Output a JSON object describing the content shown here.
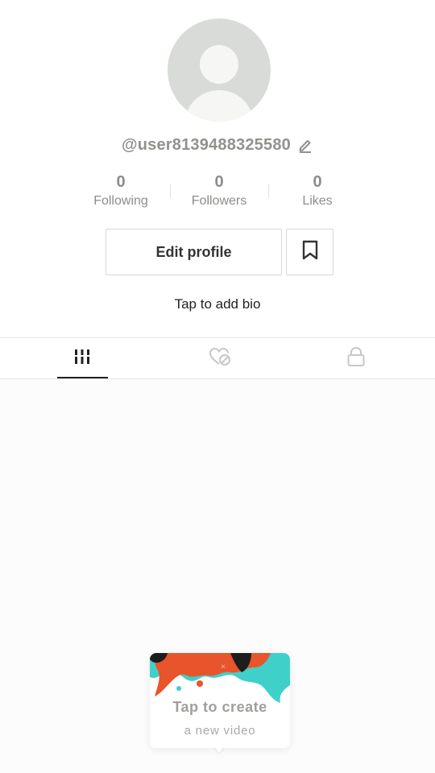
{
  "profile": {
    "username": "@user8139488325580",
    "bio_prompt": "Tap to add bio"
  },
  "stats": [
    {
      "value": "0",
      "label": "Following"
    },
    {
      "value": "0",
      "label": "Followers"
    },
    {
      "value": "0",
      "label": "Likes"
    }
  ],
  "actions": {
    "edit_profile_label": "Edit profile"
  },
  "tabs": [
    {
      "icon": "grid-icon",
      "active": true
    },
    {
      "icon": "liked-hidden-icon",
      "active": false
    },
    {
      "icon": "lock-icon",
      "active": false
    }
  ],
  "create_prompt": {
    "title": "Tap to create",
    "subtitle": "a new video"
  },
  "colors": {
    "accent_orange": "#e8542b",
    "accent_teal": "#3fd0c9",
    "text_muted": "#8a8d88"
  }
}
